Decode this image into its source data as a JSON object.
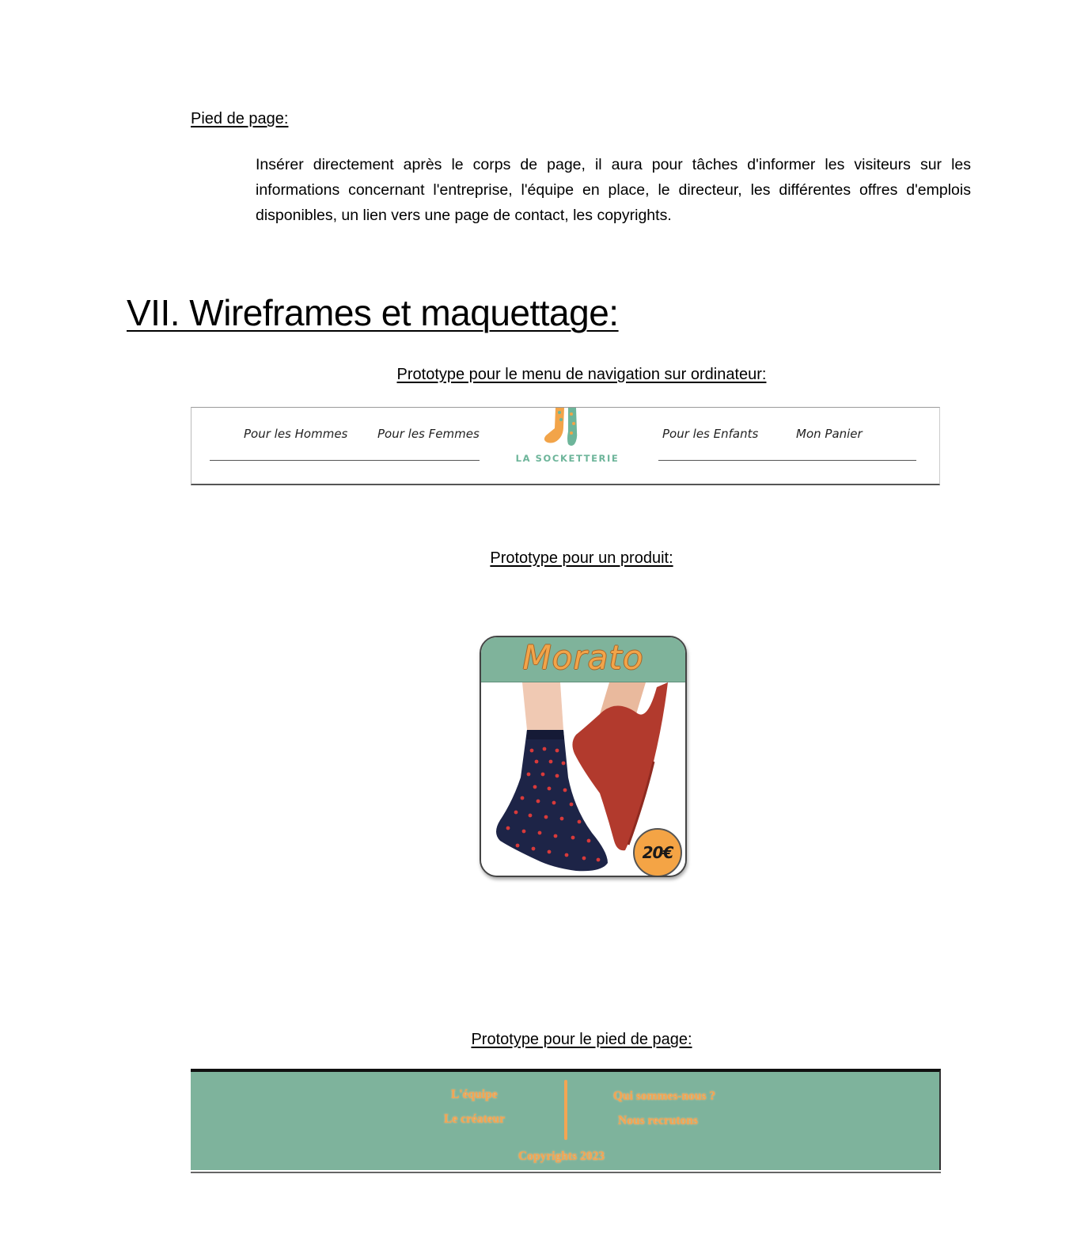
{
  "footer_section": {
    "heading": "Pied de page:",
    "description": "Insérer directement après le corps de page, il aura pour tâches d'informer les visiteurs sur les informations concernant l'entreprise, l'équipe en place, le directeur, les différentes offres d'emplois disponibles, un lien vers une page de contact, les copyrights."
  },
  "section": {
    "title": "VII. Wireframes et maquettage:"
  },
  "nav_prototype": {
    "caption": "Prototype pour le menu de navigation sur ordinateur:",
    "links": [
      "Pour les Hommes",
      "Pour les Femmes",
      "Pour les Enfants",
      "Mon Panier"
    ],
    "brand": "LA SOCKETTERIE",
    "logo_icon": "socks-logo-icon",
    "colors": {
      "brand": "#6db59a",
      "accent": "#f2a449"
    }
  },
  "product_prototype": {
    "caption": "Prototype pour un produit:",
    "name": "Morato",
    "price": "20€",
    "image": "socks-photo",
    "colors": {
      "header": "#7fb39b",
      "name": "#f2a449",
      "badge": "#f4a445"
    }
  },
  "footer_prototype": {
    "caption": "Prototype pour le pied de page:",
    "left_links": [
      "L'équipe",
      "Le créateur"
    ],
    "right_links": [
      "Qui sommes-nous ?",
      "Nous recrutons"
    ],
    "copyright": "Copyrights 2023",
    "colors": {
      "background": "#7eb39c",
      "text": "#f3a553"
    }
  }
}
